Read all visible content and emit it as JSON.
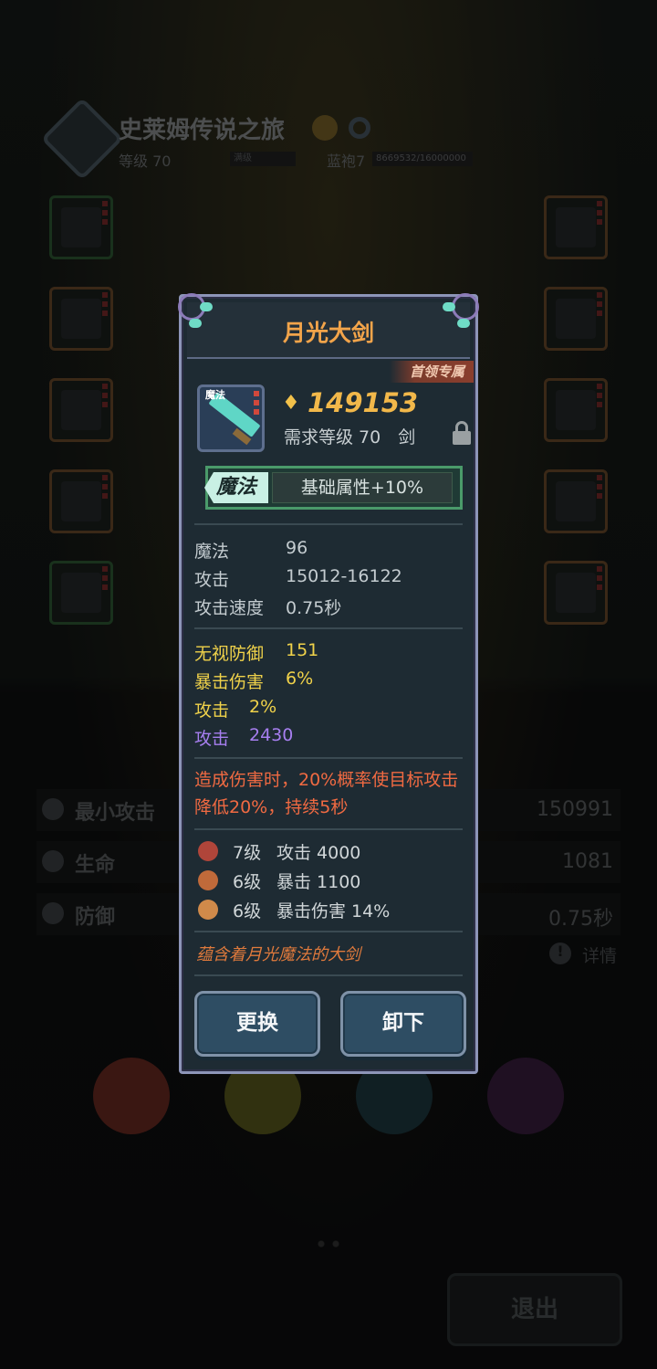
{
  "header": {
    "title": "史莱姆传说之旅",
    "level": "等级 70",
    "max_label": "满级",
    "rank": "蓝袍7",
    "exp": "8669532/16000000"
  },
  "stats_bg": [
    {
      "label": "最小攻击",
      "value": "150991"
    },
    {
      "label": "生命",
      "value": "1081"
    },
    {
      "label": "防御",
      "value": "0.75秒"
    }
  ],
  "detail_label": "详情",
  "exit_label": "退出",
  "modal": {
    "title": "月光大剑",
    "boss_tag": "首领专属",
    "item_icon_label": "魔法",
    "power": "149153",
    "requirement": "需求等级 70　剑",
    "magic_tag": "魔法",
    "magic_text": "基础属性+10%",
    "base_stats": [
      {
        "label": "魔法",
        "value": "96"
      },
      {
        "label": "攻击",
        "value": "15012-16122"
      },
      {
        "label": "攻击速度",
        "value": "0.75秒"
      }
    ],
    "extra_stats": [
      {
        "label": "无视防御",
        "value": "151",
        "color": "#f0d24a"
      },
      {
        "label": "暴击伤害",
        "value": "6%",
        "color": "#f0d24a"
      },
      {
        "label": "攻击",
        "value": "2%",
        "color": "#f0d24a"
      },
      {
        "label": "攻击",
        "value": "2430",
        "color": "#a77ff0"
      }
    ],
    "effect": "造成伤害时，20%概率使目标攻击降低20%，持续5秒",
    "gems": [
      {
        "level": "7级",
        "stat": "攻击 4000",
        "color": "#b0453a"
      },
      {
        "level": "6级",
        "stat": "暴击 1100",
        "color": "#c06a3a"
      },
      {
        "level": "6级",
        "stat": "暴击伤害 14%",
        "color": "#d08a4a"
      }
    ],
    "description": "蕴含着月光魔法的大剑",
    "replace_label": "更换",
    "unequip_label": "卸下"
  },
  "colors": {
    "title": "#f2a44a",
    "power": "#f2b84a",
    "effect": "#f06a42",
    "purple_stat": "#a77ff0",
    "yellow_stat": "#f0d24a"
  }
}
